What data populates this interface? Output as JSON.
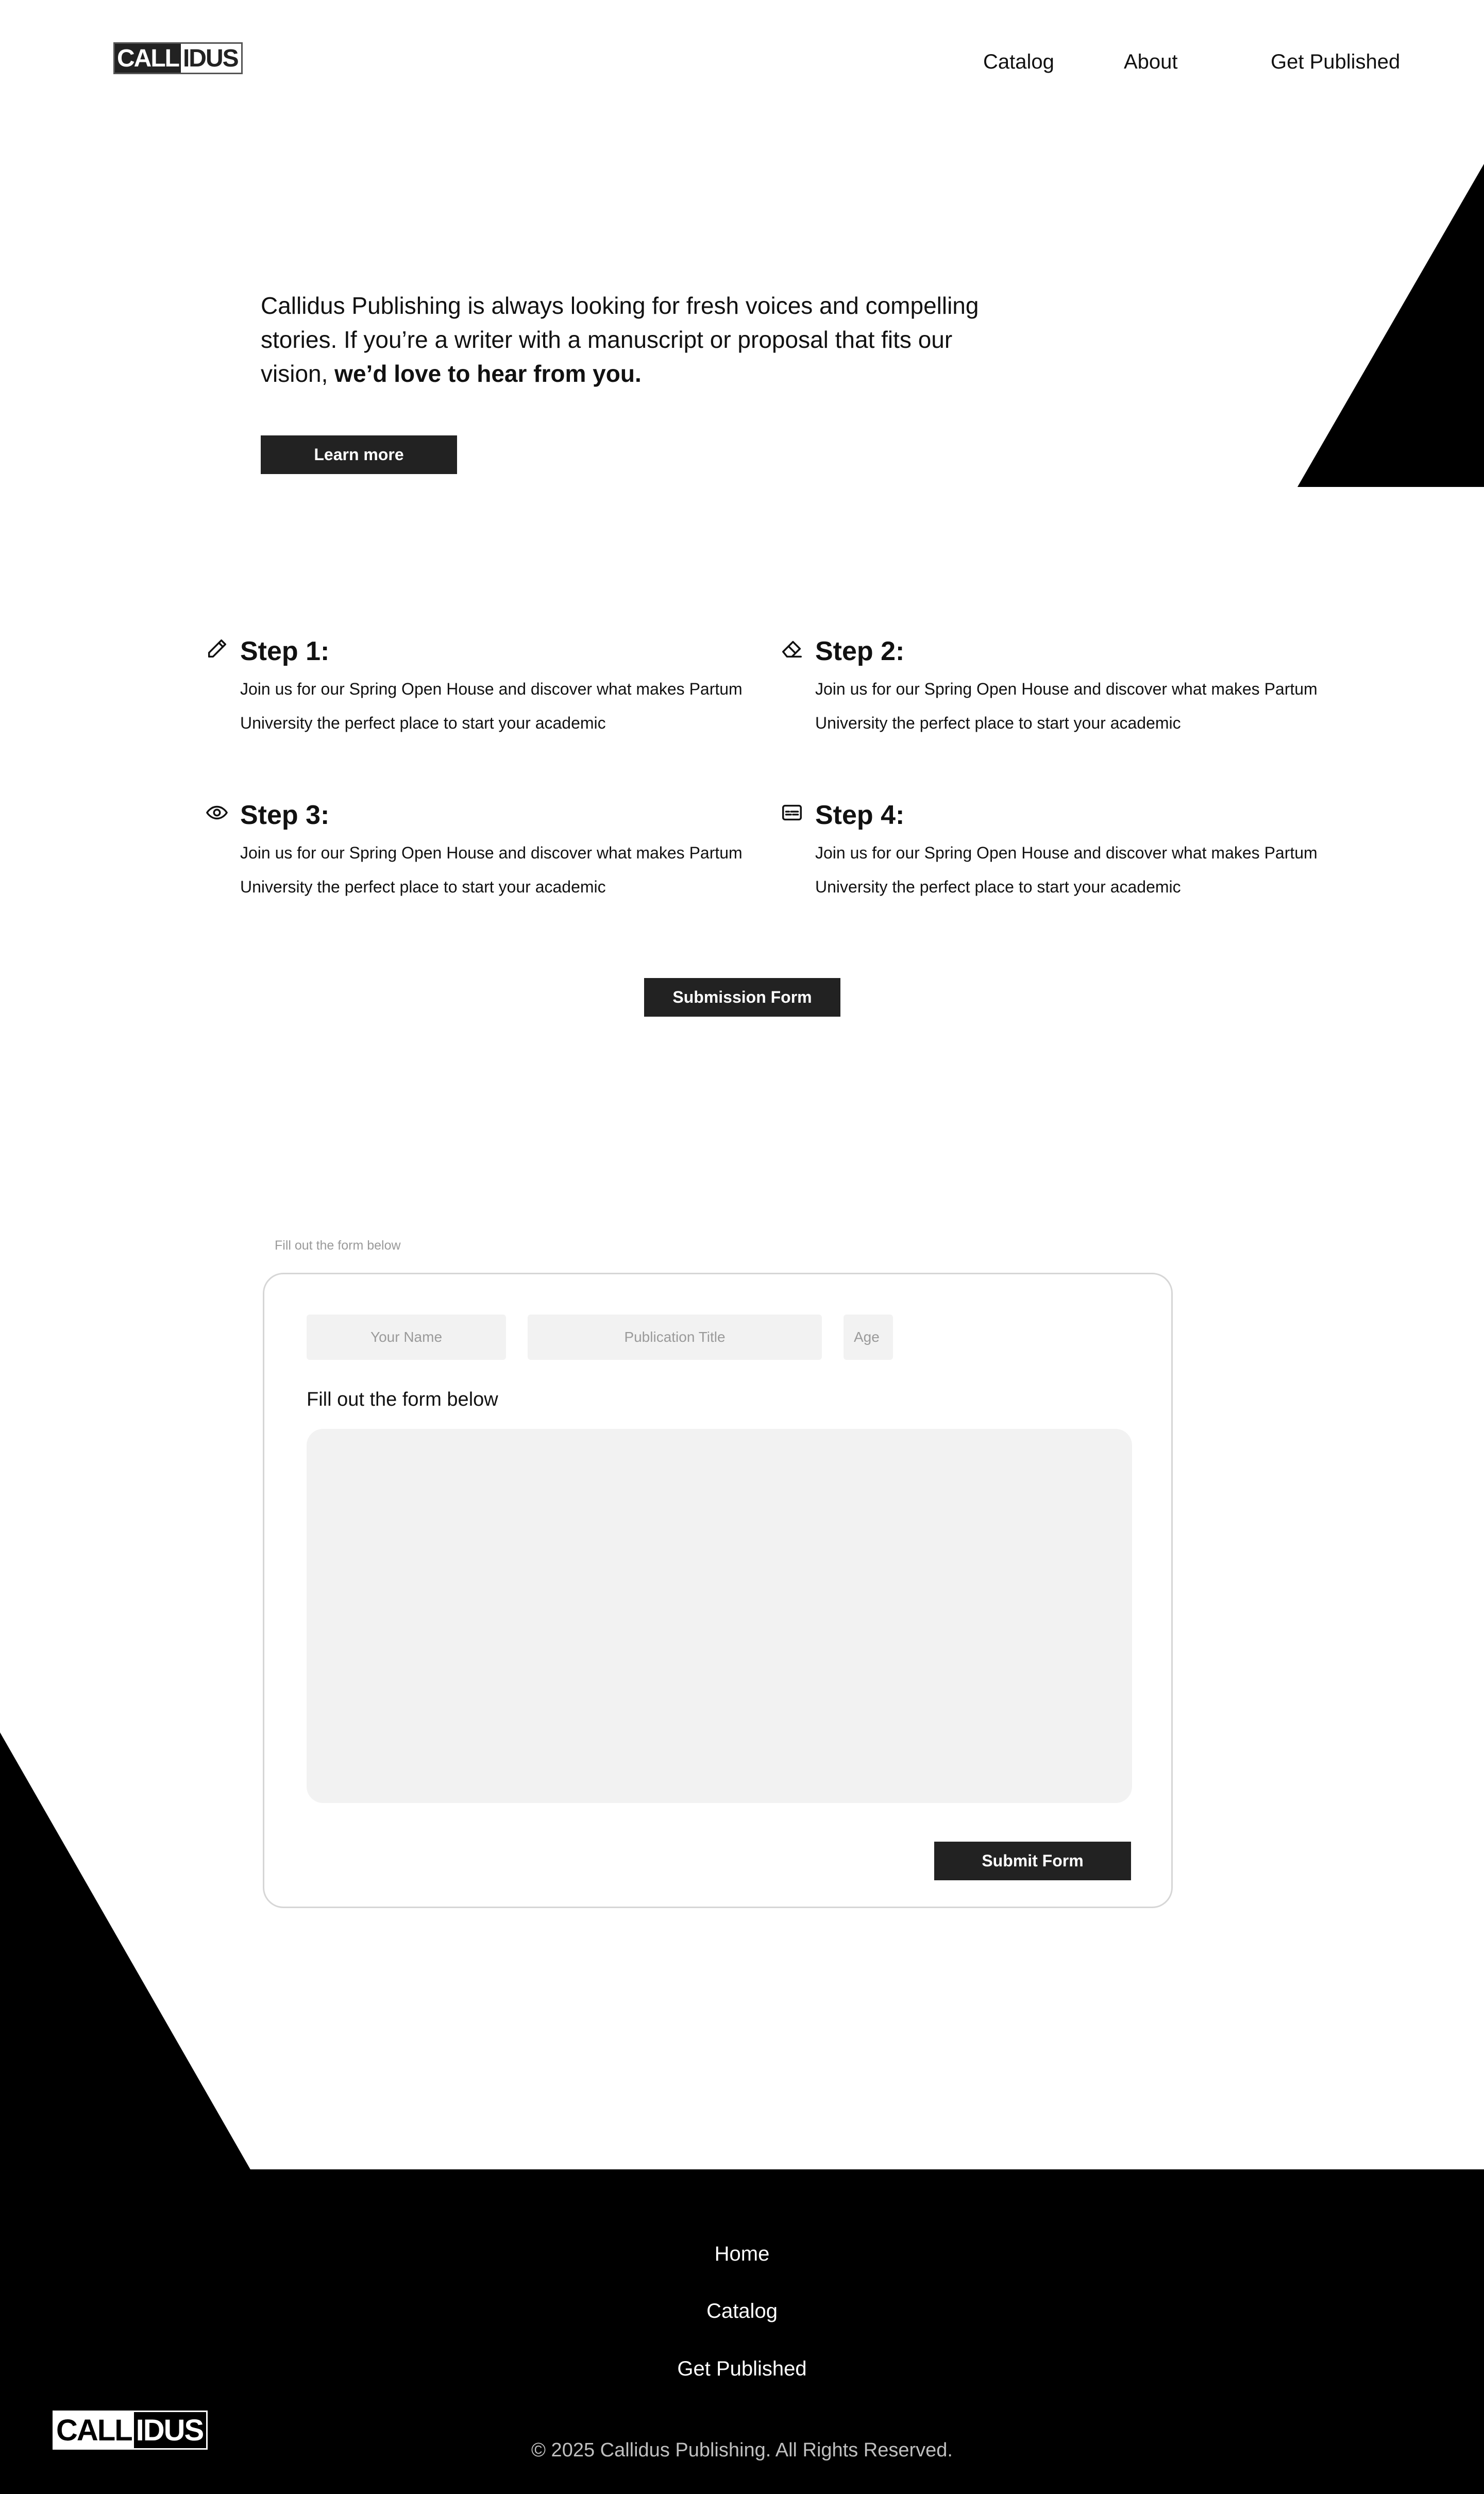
{
  "brand": {
    "logo_part1": "CALL",
    "logo_part2": "IDUS"
  },
  "nav": {
    "catalog": "Catalog",
    "about": "About",
    "get_published": "Get Published"
  },
  "hero": {
    "text_main": "Callidus Publishing is always looking for fresh voices and compelling stories. If you’re a writer with a manuscript or proposal that fits our vision, ",
    "text_bold": "we’d love to hear from you.",
    "learn_more": "Learn more"
  },
  "steps": [
    {
      "title": "Step 1:",
      "icon": "pencil-icon",
      "text": "Join us for our Spring Open House and discover what makes Partum University the perfect place to start your academic"
    },
    {
      "title": "Step 2:",
      "icon": "eraser-icon",
      "text": "Join us for our Spring Open House and discover what makes Partum University the perfect place to start your academic"
    },
    {
      "title": "Step 3:",
      "icon": "eye-icon",
      "text": "Join us for our Spring Open House and discover what makes Partum University the perfect place to start your academic"
    },
    {
      "title": "Step 4:",
      "icon": "subtitles-icon",
      "text": "Join us for our Spring Open House and discover what makes Partum University the perfect place to start your academic"
    }
  ],
  "submission_button": "Submission Form",
  "form": {
    "hint": "Fill out the form below",
    "name_placeholder": "Your Name",
    "title_placeholder": "Publication Title",
    "age_placeholder": "Age",
    "label": "Fill out the form below",
    "message_value": "",
    "submit": "Submit Form"
  },
  "footer": {
    "home": "Home",
    "catalog": "Catalog",
    "get_published": "Get Published",
    "copyright": "© 2025 Callidus Publishing. All Rights Reserved."
  },
  "colors": {
    "accent_dark": "#222222",
    "field_bg": "#f2f2f2",
    "footer_bg": "#000000"
  }
}
